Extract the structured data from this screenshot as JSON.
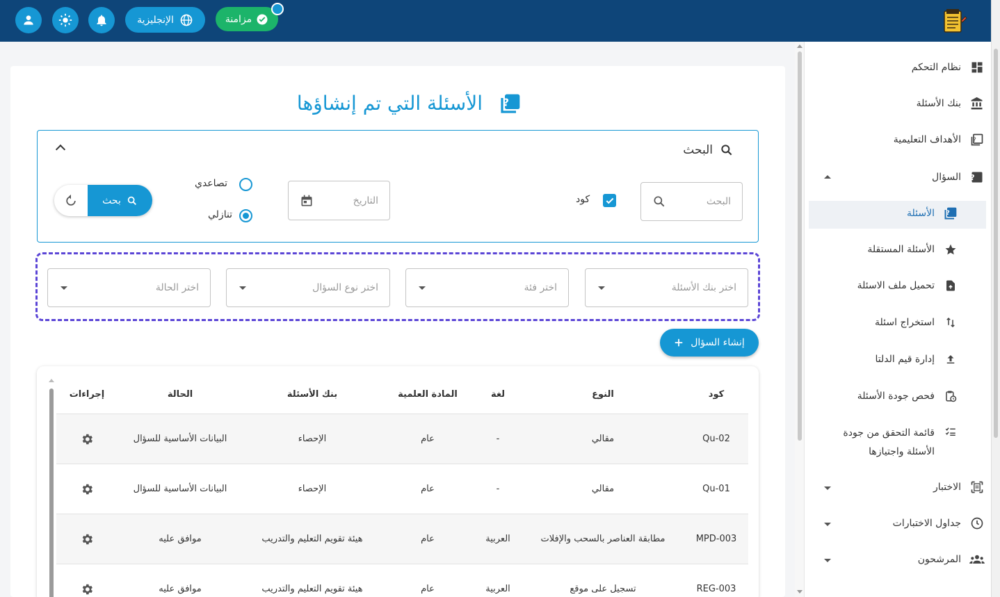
{
  "topbar": {
    "sync_label": "مزامنة",
    "language_label": "الإنجليزية",
    "colors": {
      "bar": "#0e4579",
      "accent": "#1697d4",
      "sync": "#1cb46a"
    },
    "icons": [
      "user-icon",
      "brightness-icon",
      "bell-icon",
      "globe-icon",
      "check-circle-icon",
      "exam-logo-icon"
    ]
  },
  "sidebar": {
    "items": [
      {
        "label": "نظام التحكم",
        "icon": "dashboard-icon"
      },
      {
        "label": "بنك الأسئلة",
        "icon": "bank-icon"
      },
      {
        "label": "الأهداف التعليمية",
        "icon": "objectives-icon"
      },
      {
        "label": "السؤال",
        "icon": "question-icon",
        "expanded": true
      },
      {
        "label": "الأسئلة",
        "icon": "question-book-icon",
        "active": true
      },
      {
        "label": "الأسئلة المستقلة",
        "icon": "star-icon"
      },
      {
        "label": "تحميل ملف الاسئلة",
        "icon": "file-upload-icon"
      },
      {
        "label": "استخراج اسئلة",
        "icon": "swap-vertical-icon"
      },
      {
        "label": "إدارة قيم الدلتا",
        "icon": "upload-icon"
      },
      {
        "label": "فحص جودة الأسئلة",
        "icon": "clipboard-clock-icon"
      },
      {
        "label": "قائمة التحقق من جودة",
        "label2": "الأسئلة واجتيازها",
        "icon": "checklist-icon"
      },
      {
        "label": "الاختبار",
        "icon": "exam-icon"
      },
      {
        "label": "جداول الاختبارات",
        "icon": "clock-icon"
      },
      {
        "label": "المرشحون",
        "icon": "people-icon"
      }
    ]
  },
  "page": {
    "title": "الأسئلة التي تم إنشاؤها",
    "search": {
      "heading": "البحث",
      "search_placeholder": "البحث",
      "code_checkbox_label": "كود",
      "code_checked": true,
      "date_placeholder": "التاريخ",
      "sort_asc_label": "تصاعدي",
      "sort_desc_label": "تنازلي",
      "sort_selected": "desc",
      "search_button": "بحث"
    },
    "filters": {
      "bank": "اختر بنك الأسئلة",
      "category": "اختر فئة",
      "question_type": "اختر نوع السؤال",
      "status": "اختر الحالة"
    },
    "create_button": "إنشاء السؤال"
  },
  "table": {
    "headers": {
      "code": "كود",
      "type": "النوع",
      "language": "لغة",
      "subject": "المادة العلمية",
      "bank": "بنك الأسئلة",
      "status": "الحالة",
      "actions": "إجراءات"
    },
    "rows": [
      {
        "code": "Qu-02",
        "type": "مقالي",
        "language": "-",
        "subject": "عام",
        "bank": "الإحصاء",
        "status": "البيانات الأساسية للسؤال"
      },
      {
        "code": "Qu-01",
        "type": "مقالي",
        "language": "-",
        "subject": "عام",
        "bank": "الإحصاء",
        "status": "البيانات الأساسية للسؤال"
      },
      {
        "code": "MPD-003",
        "type": "مطابقة العناصر بالسحب والإفلات",
        "language": "العربية",
        "subject": "عام",
        "bank": "هيئة تقويم التعليم والتدريب",
        "status": "موافق عليه"
      },
      {
        "code": "REG-003",
        "type": "تسجيل على موقع",
        "language": "العربية",
        "subject": "عام",
        "bank": "هيئة تقويم التعليم والتدريب",
        "status": "موافق عليه"
      }
    ]
  }
}
